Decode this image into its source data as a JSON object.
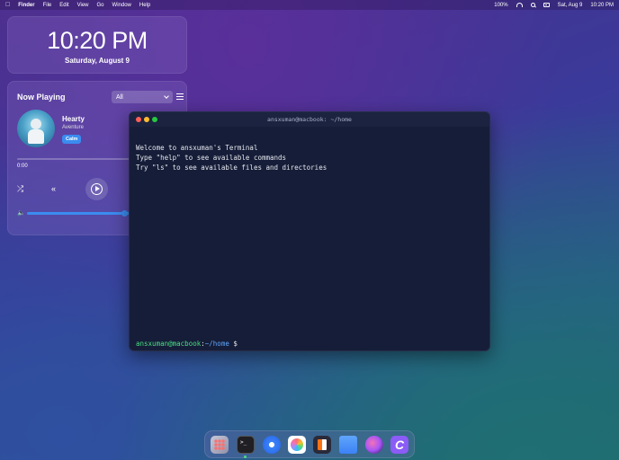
{
  "menubar": {
    "app_name": "Finder",
    "menus": [
      "File",
      "Edit",
      "View",
      "Go",
      "Window",
      "Help"
    ],
    "battery": "100%",
    "date": "Sat, Aug 9",
    "time": "10:20 PM"
  },
  "clock_widget": {
    "time": "10:20 PM",
    "date": "Saturday, August 9"
  },
  "music_widget": {
    "title": "Now Playing",
    "filter_value": "All",
    "track": {
      "title": "Hearty",
      "artist": "Aventure",
      "tag": "Calm"
    },
    "progress": 0.0,
    "elapsed": "0:00",
    "volume": 0.9
  },
  "terminal": {
    "title": "ansxuman@macbook: ~/home",
    "lines": [
      "Welcome to ansxuman's Terminal",
      "Type \"help\" to see available commands",
      "Try \"ls\" to see available files and directories"
    ],
    "prompt_user": "ansxuman@macbook",
    "prompt_sep": ":",
    "prompt_path": "~/home",
    "prompt_symbol": "$"
  },
  "dock": {
    "apps": [
      "launchpad-icon",
      "terminal-icon",
      "safari-icon",
      "photos-icon",
      "books-icon",
      "folder-icon",
      "siri-icon",
      "canva-icon"
    ]
  }
}
